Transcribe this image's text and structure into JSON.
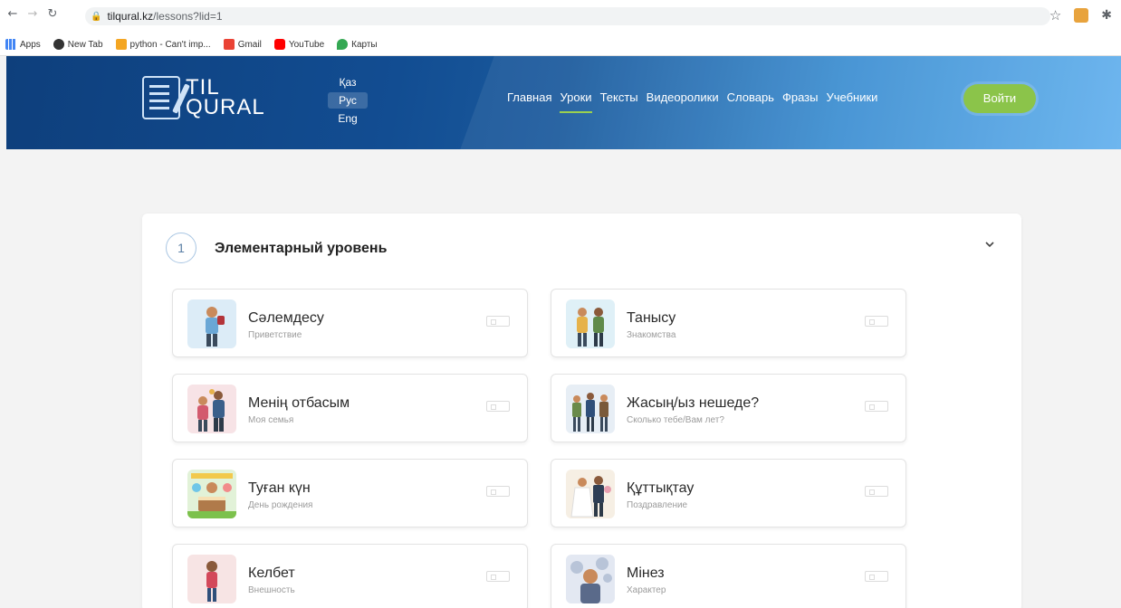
{
  "browser": {
    "url_host": "tilqural.kz",
    "url_path": "/lessons?lid=1",
    "bookmarks": [
      {
        "label": "Apps",
        "icon": "apps-icon"
      },
      {
        "label": "New Tab",
        "icon": "new-tab-icon"
      },
      {
        "label": "python - Can't imp...",
        "icon": "python-icon"
      },
      {
        "label": "Gmail",
        "icon": "gmail-icon"
      },
      {
        "label": "YouTube",
        "icon": "youtube-icon"
      },
      {
        "label": "Карты",
        "icon": "maps-icon"
      }
    ]
  },
  "header": {
    "logo_line1": "TIL",
    "logo_line2": "QURAL",
    "languages": [
      "Қаз",
      "Рус",
      "Eng"
    ],
    "active_language": "Рус",
    "menu": [
      "Главная",
      "Уроки",
      "Тексты",
      "Видеоролики",
      "Словарь",
      "Фразы",
      "Учебники"
    ],
    "active_menu": "Уроки",
    "login_label": "Войти",
    "accent_color": "#8bc44a"
  },
  "section": {
    "number": "1",
    "title": "Элементарный уровень"
  },
  "lessons": [
    {
      "title": "Сәлемдесу",
      "subtitle": "Приветствие"
    },
    {
      "title": "Танысу",
      "subtitle": "Знакомства"
    },
    {
      "title": "Менің отбасым",
      "subtitle": "Моя семья"
    },
    {
      "title": "Жасың/ыз нешеде?",
      "subtitle": "Сколько тебе/Вам лет?"
    },
    {
      "title": "Туған күн",
      "subtitle": "День рождения"
    },
    {
      "title": "Құттықтау",
      "subtitle": "Поздравление"
    },
    {
      "title": "Келбет",
      "subtitle": "Внешность"
    },
    {
      "title": "Мінез",
      "subtitle": "Характер"
    }
  ]
}
